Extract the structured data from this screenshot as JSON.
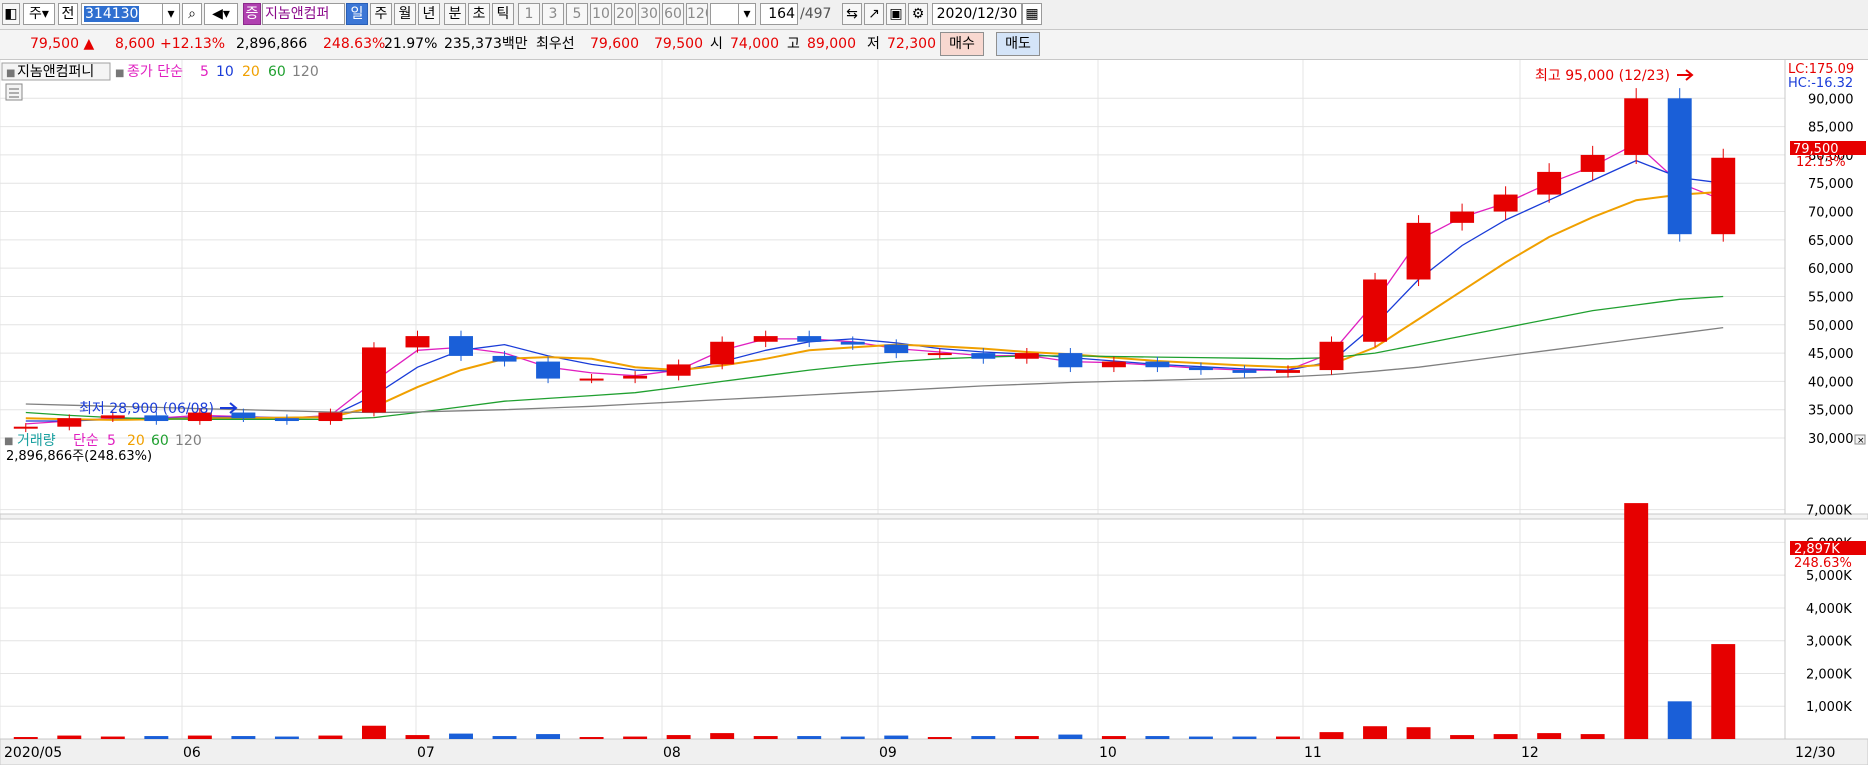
{
  "toolbar": {
    "type_select": "주",
    "prefix_label": "전",
    "stock_code": "314130",
    "stock_name": "지놈앤컴퍼",
    "badge": "증",
    "periods": [
      "일",
      "주",
      "월",
      "년",
      "분",
      "초",
      "틱"
    ],
    "active_period": "일",
    "intervals": [
      "1",
      "3",
      "5",
      "10",
      "20",
      "30",
      "60",
      "120"
    ],
    "count": "164",
    "total": "/497",
    "date": "2020/12/30"
  },
  "info": {
    "price": "79,500",
    "change": "8,600",
    "change_pct": "+12.13%",
    "volume": "2,896,866",
    "volume_ratio": "248.63%",
    "turnover": "21.97%",
    "amount": "235,373백만",
    "bid_label": "최우선",
    "bid1": "79,600",
    "bid2": "79,500",
    "open_label": "시",
    "open": "74,000",
    "high_label": "고",
    "high": "89,000",
    "low_label": "저",
    "low": "72,300",
    "buy_label": "매수",
    "sell_label": "매도"
  },
  "price_pane": {
    "stock_name": "지놈앤컴퍼니",
    "legend_prefix": "종가 단순",
    "ma_periods": [
      "5",
      "10",
      "20",
      "60",
      "120"
    ],
    "ma_colors": [
      "#e020c0",
      "#1a3cd8",
      "#f0a000",
      "#20a030",
      "#808080"
    ],
    "lc": "LC:175.09",
    "hc": "HC:-16.32",
    "last_price": "79,500",
    "last_pct": "12.13%",
    "high_annotation": "최고 95,000 (12/23)",
    "low_annotation": "최저 28,900 (06/08)",
    "y_ticks": [
      "90,000",
      "85,000",
      "80,000",
      "75,000",
      "70,000",
      "65,000",
      "60,000",
      "55,000",
      "50,000",
      "45,000",
      "40,000",
      "35,000",
      "30,000"
    ]
  },
  "volume_pane": {
    "legend_title": "거래량",
    "legend_prefix": "단순",
    "ma_periods": [
      "5",
      "20",
      "60",
      "120"
    ],
    "current_volume": "2,896,866주(248.63%)",
    "last_value": "2,897K",
    "last_pct": "248.63%",
    "y_ticks": [
      "7,000K",
      "6,000K",
      "5,000K",
      "4,000K",
      "3,000K",
      "2,000K",
      "1,000K"
    ]
  },
  "x_axis": {
    "labels": [
      "2020/05",
      "06",
      "07",
      "08",
      "09",
      "10",
      "11",
      "12",
      "12/30"
    ]
  },
  "colors": {
    "up": "#e60000",
    "down": "#1a5fd8",
    "grid": "#e4e4e4"
  },
  "chart_data": {
    "type": "candlestick",
    "x": [
      "2020/05",
      "06",
      "07",
      "08",
      "09",
      "10",
      "11",
      "12",
      "12/30"
    ],
    "ylim": [
      27000,
      95000
    ],
    "series": [
      {
        "name": "종가",
        "values": [
          32000,
          33500,
          34000,
          33000,
          34500,
          33500,
          33000,
          34500,
          46000,
          48000,
          44500,
          43500,
          40500,
          40500,
          41000,
          43000,
          47000,
          48000,
          47000,
          46500,
          45000,
          45000,
          44000,
          45000,
          42500,
          43500,
          42500,
          42000,
          41500,
          42000,
          47000,
          58000,
          68000,
          70000,
          73000,
          77000,
          80000,
          90000,
          66000,
          79500
        ]
      },
      {
        "name": "5",
        "values": [
          32500,
          33000,
          33500,
          33500,
          34000,
          33800,
          33500,
          34000,
          40000,
          45500,
          46000,
          45000,
          42500,
          41500,
          41000,
          42000,
          45500,
          47500,
          47500,
          47000,
          45800,
          45200,
          44500,
          44600,
          43500,
          43300,
          42800,
          42300,
          42000,
          42000,
          45000,
          54000,
          65000,
          69000,
          71500,
          75000,
          78000,
          82000,
          75000,
          72000
        ]
      },
      {
        "name": "10",
        "values": [
          33000,
          33000,
          33300,
          33400,
          33700,
          33700,
          33600,
          33800,
          37500,
          42500,
          45500,
          46500,
          44500,
          43000,
          42000,
          41800,
          43500,
          45500,
          47000,
          47500,
          46800,
          45800,
          45200,
          44800,
          44200,
          43600,
          43000,
          42600,
          42200,
          42000,
          43500,
          50000,
          58000,
          64000,
          68500,
          72000,
          75500,
          79000,
          76000,
          75000
        ]
      },
      {
        "name": "20",
        "values": [
          33500,
          33300,
          33200,
          33300,
          33500,
          33500,
          33600,
          33700,
          35500,
          39000,
          42000,
          44000,
          44300,
          44000,
          42500,
          42000,
          42800,
          44000,
          45500,
          46000,
          46500,
          46200,
          45800,
          45200,
          44800,
          44200,
          43600,
          43200,
          42800,
          42500,
          43000,
          46000,
          51000,
          56000,
          61000,
          65500,
          69000,
          72000,
          73000,
          73500
        ]
      },
      {
        "name": "60",
        "values": [
          34500,
          34000,
          33600,
          33400,
          33300,
          33300,
          33300,
          33300,
          33600,
          34500,
          35500,
          36500,
          37000,
          37500,
          38000,
          39000,
          40000,
          41000,
          42000,
          42800,
          43500,
          44000,
          44300,
          44500,
          44500,
          44400,
          44300,
          44200,
          44100,
          44000,
          44200,
          45000,
          46500,
          48000,
          49500,
          51000,
          52500,
          53500,
          54500,
          55000
        ]
      },
      {
        "name": "120",
        "values": [
          36000,
          35800,
          35600,
          35400,
          35200,
          35000,
          34800,
          34600,
          34500,
          34600,
          34800,
          35000,
          35300,
          35600,
          36000,
          36400,
          36800,
          37200,
          37600,
          38000,
          38400,
          38800,
          39200,
          39500,
          39800,
          40000,
          40200,
          40400,
          40600,
          40800,
          41200,
          41800,
          42500,
          43500,
          44500,
          45500,
          46500,
          47500,
          48500,
          49500
        ]
      }
    ]
  }
}
